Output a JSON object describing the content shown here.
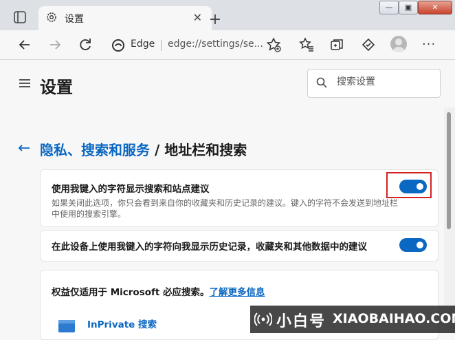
{
  "tab": {
    "title": "设置",
    "close": "✕",
    "new_tab": "+"
  },
  "window_controls": {
    "minimize": "—",
    "restore": "▣",
    "close": "✕"
  },
  "address_bar": {
    "brand": "Edge",
    "url": "edge://settings/se..."
  },
  "header": {
    "title": "设置",
    "search_placeholder": "搜索设置"
  },
  "breadcrumb": {
    "parent": "隐私、搜索和服务",
    "separator": " / ",
    "current": "地址栏和搜索"
  },
  "settings": [
    {
      "title": "使用我键入的字符显示搜索和站点建议",
      "description": "如果关闭此选项，你只会看到来自你的收藏夹和历史记录的建议。键入的字符不会发送到地址栏中使用的搜索引擎。",
      "enabled": true
    },
    {
      "title": "在此设备上使用我键入的字符向我显示历史记录，收藏夹和其他数据中的建议",
      "enabled": true
    }
  ],
  "notice": {
    "text": "权益仅适用于 Microsoft 必应搜索。",
    "link": "了解更多信息"
  },
  "inprivate": {
    "label": "InPrivate 搜索"
  },
  "watermark": {
    "cn": "小白号",
    "en": "XIAOBAIHAO.COM"
  },
  "colors": {
    "accent": "#0a67c2",
    "highlight": "#d42020"
  }
}
